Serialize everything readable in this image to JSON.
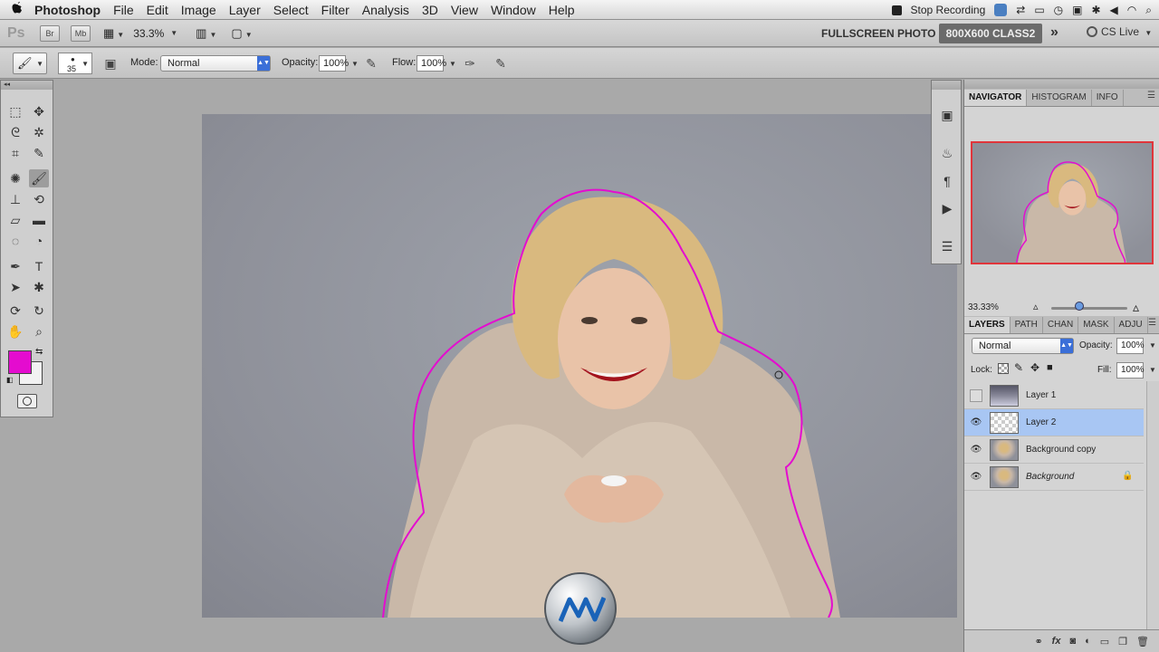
{
  "menubar": {
    "app_name": "Photoshop",
    "menus": [
      "File",
      "Edit",
      "Image",
      "Layer",
      "Select",
      "Filter",
      "Analysis",
      "3D",
      "View",
      "Window",
      "Help"
    ],
    "status": "Stop Recording",
    "icons": [
      "apple-icon",
      "recording-stop-icon",
      "bluetooth-icon",
      "wifi-icon",
      "volume-icon",
      "spotlight-icon"
    ]
  },
  "appbar": {
    "logo": "Ps",
    "br": "Br",
    "mb": "Mb",
    "zoom": "33.3%",
    "workspace_fullscreen": "FULLSCREEN PHOTO",
    "workspace_active": "800X600 CLASS2",
    "more": "»",
    "cs_live": "CS Live"
  },
  "options": {
    "brush_size": "35",
    "mode_label": "Mode:",
    "mode_value": "Normal",
    "opacity_label": "Opacity:",
    "opacity_value": "100%",
    "flow_label": "Flow:",
    "flow_value": "100%"
  },
  "colors": {
    "foreground": "#e40ccf",
    "background": "#f2f2f2",
    "selection_outline": "#e40ccf",
    "layer_selected": "#a8c6f3"
  },
  "navigator": {
    "tabs": [
      "NAVIGATOR",
      "HISTOGRAM",
      "INFO"
    ],
    "zoom": "33.33%"
  },
  "layers_panel": {
    "tabs": [
      "LAYERS",
      "PATH",
      "CHAN",
      "MASK",
      "ADJU"
    ],
    "blend_mode": "Normal",
    "opacity_label": "Opacity:",
    "opacity_value": "100%",
    "lock_label": "Lock:",
    "fill_label": "Fill:",
    "fill_value": "100%",
    "layers": [
      {
        "name": "Layer 1",
        "visible": false,
        "selected": false
      },
      {
        "name": "Layer 2",
        "visible": true,
        "selected": true
      },
      {
        "name": "Background copy",
        "visible": true,
        "selected": false
      },
      {
        "name": "Background",
        "visible": true,
        "selected": false,
        "locked": true
      }
    ],
    "bottom_icons": [
      "link-icon",
      "fx-icon",
      "mask-icon",
      "adjustment-icon",
      "group-icon",
      "new-layer-icon",
      "trash-icon"
    ]
  }
}
